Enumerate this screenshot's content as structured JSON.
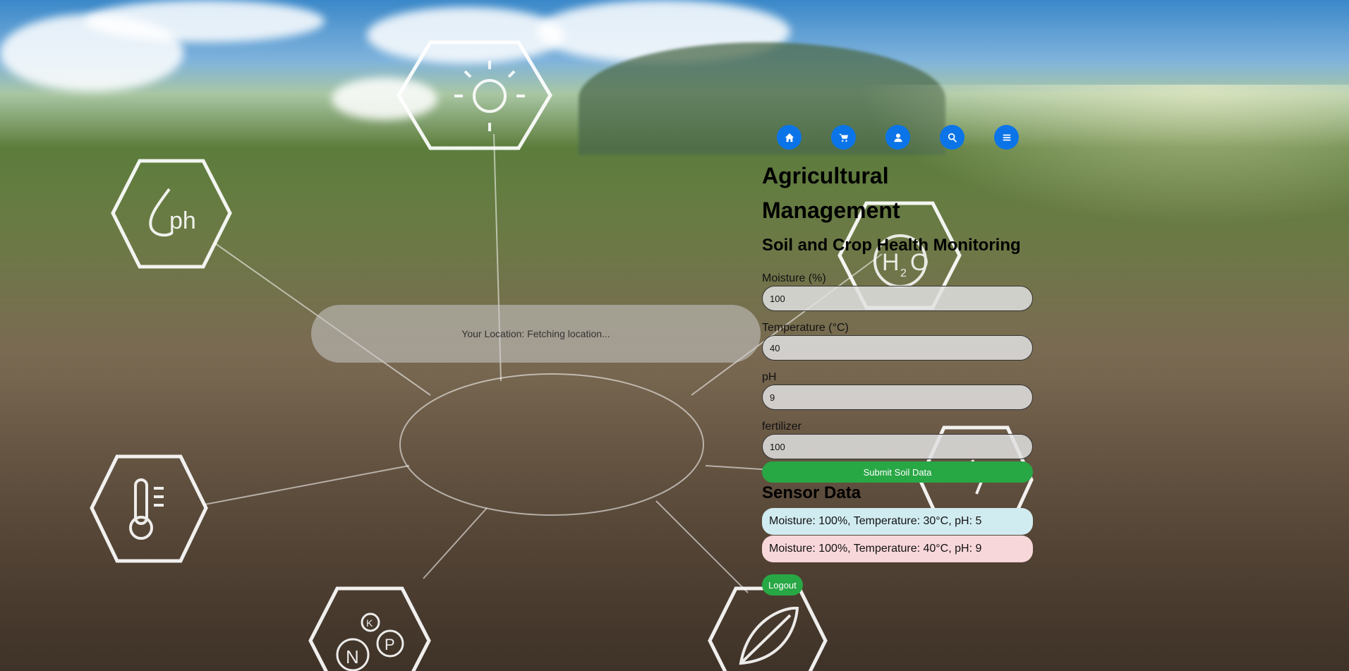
{
  "nav": {
    "items": [
      {
        "icon": "home-icon"
      },
      {
        "icon": "cart-icon"
      },
      {
        "icon": "user-icon"
      },
      {
        "icon": "search-icon"
      },
      {
        "icon": "menu-icon"
      }
    ],
    "accent": "#0b74e8"
  },
  "header": {
    "title": "Agricultural Management",
    "subtitle": "Soil and Crop Health Monitoring"
  },
  "form": {
    "fields": [
      {
        "label": "Moisture (%)",
        "value": "100"
      },
      {
        "label": "Temperature (°C)",
        "value": "40"
      },
      {
        "label": "pH",
        "value": "9"
      },
      {
        "label": "fertilizer",
        "value": "100"
      }
    ],
    "submit_label": "Submit Soil Data",
    "submit_color": "#28a745"
  },
  "sensor": {
    "heading": "Sensor Data",
    "readings": [
      {
        "text": "Moisture: 100%, Temperature: 30°C, pH: 5",
        "status": "info",
        "color": "#d1ecf1"
      },
      {
        "text": "Moisture: 100%, Temperature: 40°C, pH: 9",
        "status": "alert",
        "color": "#f8d7da"
      }
    ]
  },
  "logout_label": "Logout",
  "location": {
    "text": "Your Location: Fetching location..."
  },
  "background": {
    "hexagon_icons": [
      "sun-icon",
      "ph-icon",
      "water-h2o-icon",
      "thermometer-icon",
      "npk-icon",
      "leaf-icon",
      "irrigation-icon"
    ],
    "hexagon_labels": {
      "ph": "ph",
      "water": "H2O",
      "n": "N",
      "p": "P",
      "k": "K"
    }
  }
}
